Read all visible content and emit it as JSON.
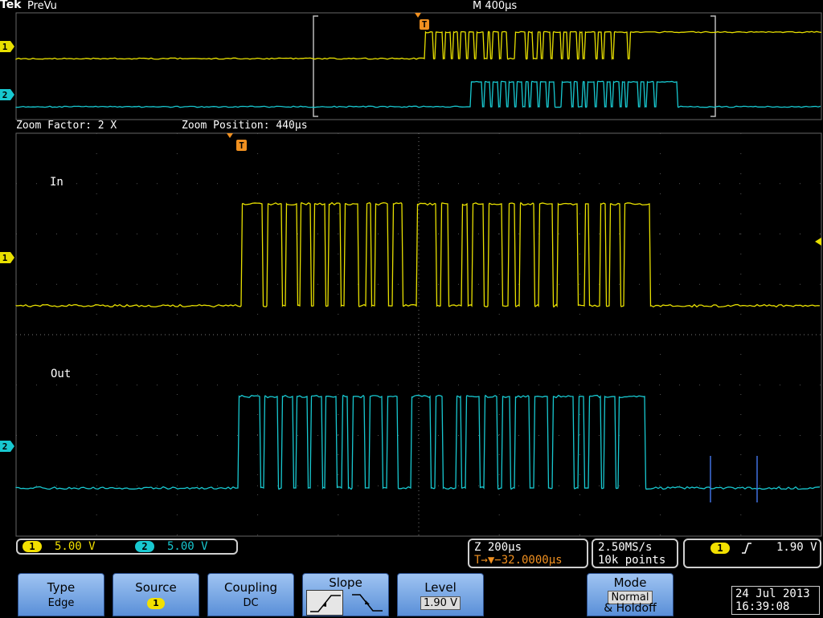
{
  "header": {
    "brand": "Tek",
    "mode": "PreVu",
    "timebase": "M 400µs"
  },
  "zoom": {
    "factor": "Zoom Factor: 2 X",
    "position": "Zoom Position: 440µs"
  },
  "trigger_marker": "T",
  "channels": [
    {
      "id": "1",
      "label": "In",
      "scale": "5.00 V",
      "color": "#e8e000"
    },
    {
      "id": "2",
      "label": "Out",
      "scale": "5.00 V",
      "color": "#18c8d0"
    }
  ],
  "status": {
    "zoom_time": "Z 200µs",
    "trigger_delay": "T→▼−32.0000µs",
    "sample_rate": "2.50MS/s",
    "record_length": "10k points",
    "trigger_channel": "1",
    "trigger_level": "1.90 V"
  },
  "softkeys": {
    "type_label": "Type",
    "type_value": "Edge",
    "source_label": "Source",
    "source_value": "1",
    "coupling_label": "Coupling",
    "coupling_value": "DC",
    "slope_label": "Slope",
    "level_label": "Level",
    "level_value": "1.90 V",
    "mode_label": "Mode",
    "mode_value1": "Normal",
    "mode_value2": "& Holdoff"
  },
  "datetime": {
    "date": "24 Jul  2013",
    "time": "16:39:08"
  },
  "colors": {
    "ch1": "#e8e000",
    "ch2": "#18c8d0",
    "trigger": "#f09020",
    "softkey": "#7aa8e8"
  }
}
